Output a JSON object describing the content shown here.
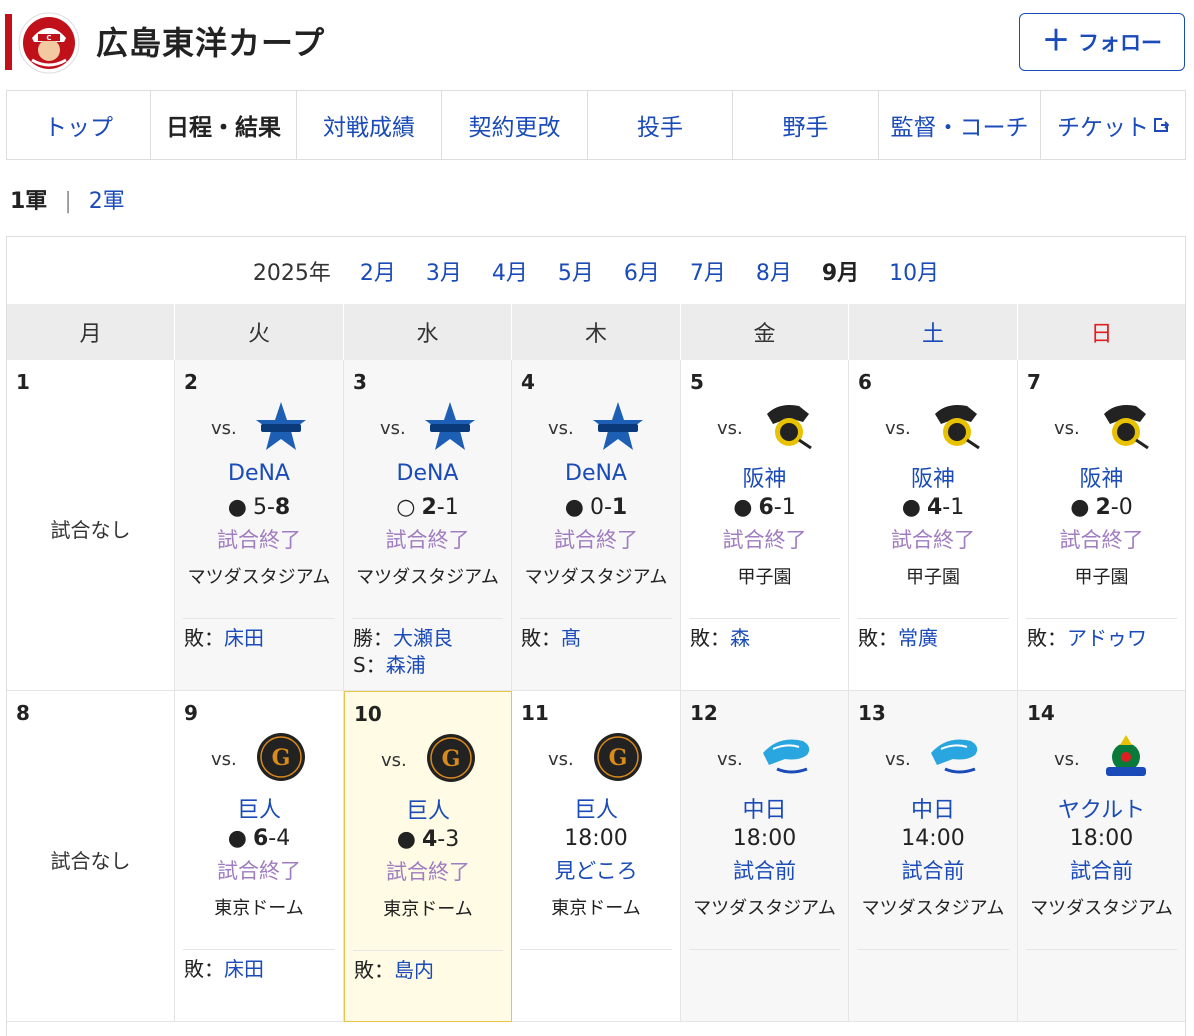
{
  "header": {
    "title": "広島東洋カープ",
    "follow_label": "フォロー"
  },
  "nav": [
    {
      "label": "トップ",
      "active": false
    },
    {
      "label": "日程・結果",
      "active": true
    },
    {
      "label": "対戦成績",
      "active": false
    },
    {
      "label": "契約更改",
      "active": false
    },
    {
      "label": "投手",
      "active": false
    },
    {
      "label": "野手",
      "active": false
    },
    {
      "label": "監督・コーチ",
      "active": false
    },
    {
      "label": "チケット",
      "active": false,
      "external": true
    }
  ],
  "league": {
    "current": "1軍",
    "other": "2軍"
  },
  "months": {
    "year": "2025年",
    "items": [
      "2月",
      "3月",
      "4月",
      "5月",
      "6月",
      "7月",
      "8月",
      "9月",
      "10月"
    ],
    "current": "9月"
  },
  "weekdays": [
    "月",
    "火",
    "水",
    "木",
    "金",
    "土",
    "日"
  ],
  "week1": {
    "mon": {
      "day": "1",
      "no_game": "試合なし"
    },
    "tue": {
      "day": "2",
      "vs": "vs.",
      "opponent": "DeNA",
      "mark": "●",
      "score_own": "5",
      "dash": "-",
      "score_opp": "8",
      "status": "試合終了",
      "venue": "マツダスタジアム",
      "pitch1_role": "敗：",
      "pitch1_name": "床田"
    },
    "wed": {
      "day": "3",
      "vs": "vs.",
      "opponent": "DeNA",
      "mark": "○",
      "score_own": "2",
      "dash": "-",
      "score_opp": "1",
      "status": "試合終了",
      "venue": "マツダスタジアム",
      "pitch1_role": "勝：",
      "pitch1_name": "大瀬良",
      "pitch2_role": "S：",
      "pitch2_name": "森浦"
    },
    "thu": {
      "day": "4",
      "vs": "vs.",
      "opponent": "DeNA",
      "mark": "●",
      "score_own": "0",
      "dash": "-",
      "score_opp": "1",
      "status": "試合終了",
      "venue": "マツダスタジアム",
      "pitch1_role": "敗：",
      "pitch1_name": "髙"
    },
    "fri": {
      "day": "5",
      "vs": "vs.",
      "opponent": "阪神",
      "mark": "●",
      "score_own": "6",
      "dash": "-",
      "score_opp": "1",
      "status": "試合終了",
      "venue": "甲子園",
      "pitch1_role": "敗：",
      "pitch1_name": "森"
    },
    "sat": {
      "day": "6",
      "vs": "vs.",
      "opponent": "阪神",
      "mark": "●",
      "score_own": "4",
      "dash": "-",
      "score_opp": "1",
      "status": "試合終了",
      "venue": "甲子園",
      "pitch1_role": "敗：",
      "pitch1_name": "常廣"
    },
    "sun": {
      "day": "7",
      "vs": "vs.",
      "opponent": "阪神",
      "mark": "●",
      "score_own": "2",
      "dash": "-",
      "score_opp": "0",
      "status": "試合終了",
      "venue": "甲子園",
      "pitch1_role": "敗：",
      "pitch1_name": "アドゥワ"
    }
  },
  "week2": {
    "mon": {
      "day": "8",
      "no_game": "試合なし"
    },
    "tue": {
      "day": "9",
      "vs": "vs.",
      "opponent": "巨人",
      "mark": "●",
      "score_own": "6",
      "dash": "-",
      "score_opp": "4",
      "status": "試合終了",
      "venue": "東京ドーム",
      "pitch1_role": "敗：",
      "pitch1_name": "床田"
    },
    "wed": {
      "day": "10",
      "vs": "vs.",
      "opponent": "巨人",
      "mark": "●",
      "score_own": "4",
      "dash": "-",
      "score_opp": "3",
      "status": "試合終了",
      "venue": "東京ドーム",
      "pitch1_role": "敗：",
      "pitch1_name": "島内"
    },
    "thu": {
      "day": "11",
      "vs": "vs.",
      "opponent": "巨人",
      "time": "18:00",
      "status": "見どころ",
      "venue": "東京ドーム"
    },
    "fri": {
      "day": "12",
      "vs": "vs.",
      "opponent": "中日",
      "time": "18:00",
      "status": "試合前",
      "venue": "マツダスタジアム"
    },
    "sat": {
      "day": "13",
      "vs": "vs.",
      "opponent": "中日",
      "time": "14:00",
      "status": "試合前",
      "venue": "マツダスタジアム"
    },
    "sun": {
      "day": "14",
      "vs": "vs.",
      "opponent": "ヤクルト",
      "time": "18:00",
      "status": "試合前",
      "venue": "マツダスタジアム"
    }
  },
  "colors": {
    "accent": "#1a4bb8",
    "brand_red": "#c0101a",
    "finished": "#a07cc0",
    "today_bg": "#fffbe4"
  }
}
